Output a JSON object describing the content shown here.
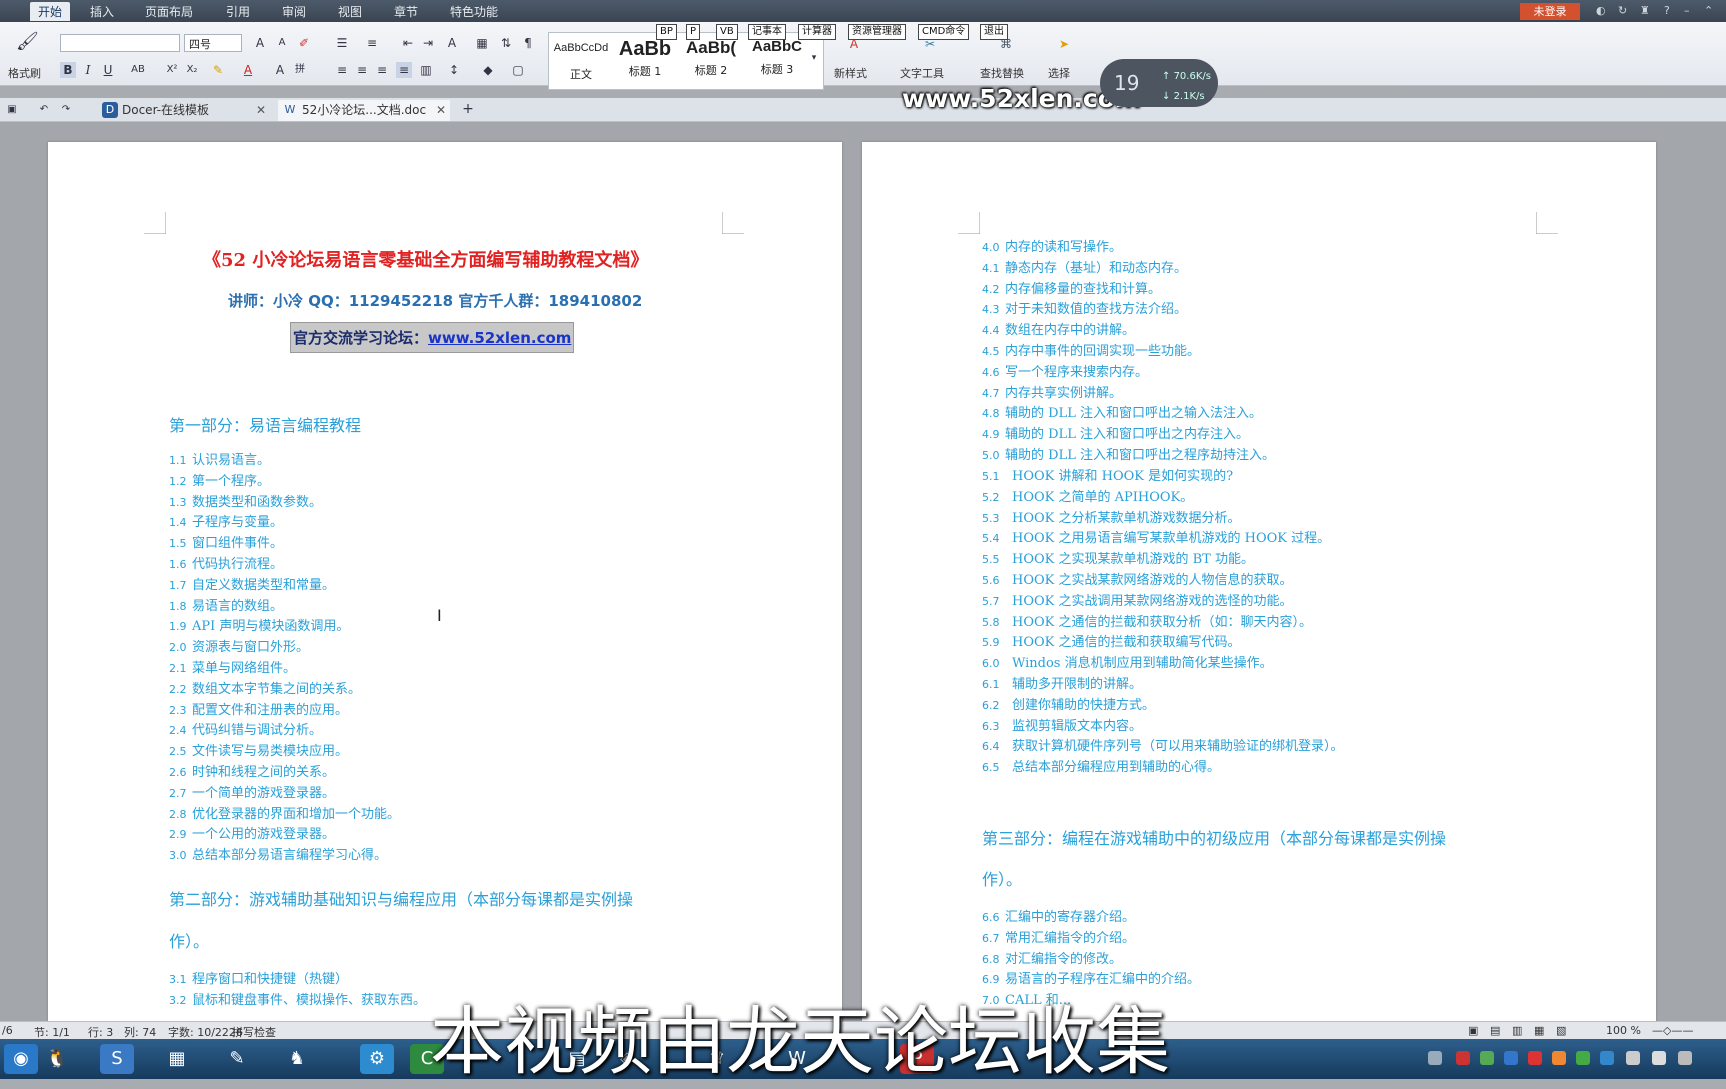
{
  "menubar": {
    "tabs": [
      "开始",
      "插入",
      "页面布局",
      "引用",
      "审阅",
      "视图",
      "章节",
      "特色功能"
    ],
    "login": "未登录",
    "help": "?"
  },
  "ribbon": {
    "format_painter": "格式刷",
    "font_name": "",
    "font_size": "四号",
    "bold": "B",
    "italic": "I",
    "underline": "U",
    "styles": [
      {
        "sample": "AaBbCcDd",
        "name": "正文"
      },
      {
        "sample": "AaBb",
        "name": "标题 1"
      },
      {
        "sample": "AaBb(",
        "name": "标题 2"
      },
      {
        "sample": "AaBbC",
        "name": "标题 3"
      }
    ],
    "new_style": "新样式",
    "text_tools": "文字工具",
    "find_replace": "查找替换",
    "select": "选择",
    "float_buttons": [
      "BP",
      "P",
      "VB",
      "记事本",
      "计算器",
      "资源管理器",
      "CMD命令",
      "退出"
    ]
  },
  "watermark": "www.52xlen.com",
  "netmon": {
    "percent": "19",
    "up": "70.6K/s",
    "down": "2.1K/s"
  },
  "doc_tabs": [
    {
      "label": "Docer-在线模板"
    },
    {
      "label": "52小冷论坛...文档.doc"
    }
  ],
  "left_page": {
    "title": "《52 小冷论坛易语言零基础全方面编写辅助教程文档》",
    "teacher": "讲师：小冷  QQ：1129452218  官方千人群：189410802",
    "forum_label": "官方交流学习论坛：",
    "forum_link": "www.52xlen.com",
    "part1": "第一部分：易语言编程教程",
    "part1_items": [
      {
        "no": "1.1",
        "text": "认识易语言。"
      },
      {
        "no": "1.2",
        "text": "第一个程序。"
      },
      {
        "no": "1.3",
        "text": "数据类型和函数参数。"
      },
      {
        "no": "1.4",
        "text": "子程序与变量。"
      },
      {
        "no": "1.5",
        "text": "窗口组件事件。"
      },
      {
        "no": "1.6",
        "text": "代码执行流程。"
      },
      {
        "no": "1.7",
        "text": "自定义数据类型和常量。"
      },
      {
        "no": "1.8",
        "text": "易语言的数组。"
      },
      {
        "no": "1.9",
        "text": "API 声明与模块函数调用。"
      },
      {
        "no": "2.0",
        "text": "资源表与窗口外形。"
      },
      {
        "no": "2.1",
        "text": "菜单与网络组件。"
      },
      {
        "no": "2.2",
        "text": "数组文本字节集之间的关系。"
      },
      {
        "no": "2.3",
        "text": "配置文件和注册表的应用。"
      },
      {
        "no": "2.4",
        "text": "代码纠错与调试分析。"
      },
      {
        "no": "2.5",
        "text": "文件读写与易类模块应用。"
      },
      {
        "no": "2.6",
        "text": "时钟和线程之间的关系。"
      },
      {
        "no": "2.7",
        "text": "一个简单的游戏登录器。"
      },
      {
        "no": "2.8",
        "text": "优化登录器的界面和增加一个功能。"
      },
      {
        "no": "2.9",
        "text": "一个公用的游戏登录器。"
      },
      {
        "no": "3.0",
        "text": "总结本部分易语言编程学习心得。"
      }
    ],
    "part2_line1": "第二部分：游戏辅助基础知识与编程应用（本部分每课都是实例操",
    "part2_line2": "作）。",
    "part2_items": [
      {
        "no": "3.1",
        "text": "程序窗口和快捷键（热键）"
      },
      {
        "no": "3.2",
        "text": "鼠标和键盘事件、模拟操作、获取东西。"
      }
    ]
  },
  "right_page": {
    "items": [
      {
        "no": "4.0",
        "text": "内存的读和写操作。"
      },
      {
        "no": "4.1",
        "text": "静态内存（基址）和动态内存。"
      },
      {
        "no": "4.2",
        "text": "内存偏移量的查找和计算。"
      },
      {
        "no": "4.3",
        "text": "对于未知数值的查找方法介绍。"
      },
      {
        "no": "4.4",
        "text": "数组在内存中的讲解。"
      },
      {
        "no": "4.5",
        "text": "内存中事件的回调实现一些功能。"
      },
      {
        "no": "4.6",
        "text": "写一个程序来搜索内存。"
      },
      {
        "no": "4.7",
        "text": "内存共享实例讲解。"
      },
      {
        "no": "4.8",
        "text": "辅助的 DLL 注入和窗口呼出之输入法注入。"
      },
      {
        "no": "4.9",
        "text": "辅助的 DLL 注入和窗口呼出之内存注入。"
      },
      {
        "no": "5.0",
        "text": "辅助的 DLL 注入和窗口呼出之程序劫持注入。"
      }
    ],
    "items_hook": [
      {
        "no": "5.1",
        "text": "HOOK 讲解和 HOOK 是如何实现的?"
      },
      {
        "no": "5.2",
        "text": "HOOK 之简单的 APIHOOK。"
      },
      {
        "no": "5.3",
        "text": "HOOK 之分析某款单机游戏数据分析。"
      },
      {
        "no": "5.4",
        "text": "HOOK 之用易语言编写某款单机游戏的 HOOK 过程。"
      },
      {
        "no": "5.5",
        "text": "HOOK 之实现某款单机游戏的 BT 功能。"
      },
      {
        "no": "5.6",
        "text": "HOOK 之实战某款网络游戏的人物信息的获取。"
      },
      {
        "no": "5.7",
        "text": "HOOK 之实战调用某款网络游戏的选怪的功能。"
      },
      {
        "no": "5.8",
        "text": "HOOK 之通信的拦截和获取分析（如：聊天内容）。"
      },
      {
        "no": "5.9",
        "text": "HOOK 之通信的拦截和获取编写代码。"
      },
      {
        "no": "6.0",
        "text": "Windos 消息机制应用到辅助简化某些操作。"
      },
      {
        "no": "6.1",
        "text": "辅助多开限制的讲解。"
      },
      {
        "no": "6.2",
        "text": "创建你辅助的快捷方式。"
      },
      {
        "no": "6.3",
        "text": "监视剪辑版文本内容。"
      },
      {
        "no": "6.4",
        "text": "获取计算机硬件序列号（可以用来辅助验证的绑机登录）。"
      },
      {
        "no": "6.5",
        "text": "总结本部分编程应用到辅助的心得。"
      }
    ],
    "part3_line1": "第三部分：编程在游戏辅助中的初级应用（本部分每课都是实例操",
    "part3_line2": "作）。",
    "part3_items": [
      {
        "no": "6.6",
        "text": "汇编中的寄存器介绍。"
      },
      {
        "no": "6.7",
        "text": "常用汇编指令的介绍。"
      },
      {
        "no": "6.8",
        "text": "对汇编指令的修改。"
      },
      {
        "no": "6.9",
        "text": "易语言的子程序在汇编中的介绍。"
      },
      {
        "no": "7.0",
        "text": "CALL 和..."
      }
    ]
  },
  "statusbar": {
    "page": "/6",
    "section": "节: 1/1",
    "row": "行: 3",
    "col": "列: 74",
    "words": "字数: 10/2226",
    "spell": "拼写检查",
    "zoom": "100 %"
  },
  "subtitle": "本视频由龙天论坛收集",
  "colors": {
    "accent_blue": "#2aa0d8",
    "title_red": "#e02222",
    "login_orange": "#d4512f"
  }
}
